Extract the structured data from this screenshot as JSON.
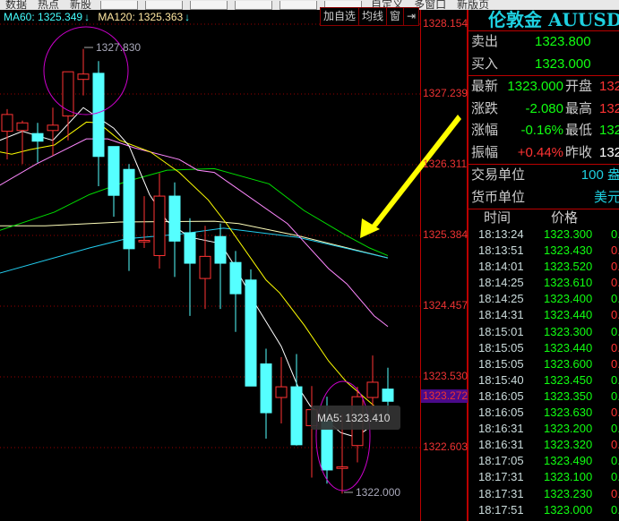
{
  "toolbar": {
    "left_items": [
      "数据",
      "热点",
      "新股"
    ],
    "right_items": [
      "自定义",
      "多窗口",
      "新版页"
    ]
  },
  "legend": {
    "ma60": "MA60: 1325.349",
    "ma60_arrow": "↓",
    "ma120": "MA120: 1325.363",
    "ma120_arrow": "↓"
  },
  "chart_buttons": [
    "加自选",
    "均线",
    "窗",
    "⇥"
  ],
  "axis_labels": [
    "1328.154",
    "1327.239",
    "1326.311",
    "1325.384",
    "1324.457",
    "1323.530",
    "1322.603"
  ],
  "current_price": "1323.272",
  "annotations": {
    "high": "1327.830",
    "low": "1322.000",
    "tooltip": "MA5: 1323.410"
  },
  "colors": {
    "up": "#ff3333",
    "down": "#55ffff",
    "ma5": "#ffffff",
    "ma10": "#ffff00",
    "ma20": "#ff88ff",
    "ma30": "#00dd00",
    "ma60": "#22ccee",
    "ma120": "#ffffbb",
    "grid": "#990000"
  },
  "chart_data": {
    "type": "candlestick",
    "ylim": [
      1322.603,
      1328.154
    ],
    "candles": [
      [
        1326.75,
        1326.97,
        1327.04,
        1326.38
      ],
      [
        1326.76,
        1326.86,
        1326.89,
        1326.32
      ],
      [
        1326.72,
        1326.62,
        1326.86,
        1326.34
      ],
      [
        1326.76,
        1326.83,
        1327.06,
        1326.43
      ],
      [
        1326.95,
        1327.53,
        1327.53,
        1326.63
      ],
      [
        1327.43,
        1327.5,
        1327.83,
        1327.22
      ],
      [
        1327.51,
        1326.42,
        1327.67,
        1326.03
      ],
      [
        1326.55,
        1325.91,
        1326.55,
        1325.63
      ],
      [
        1326.25,
        1325.21,
        1326.32,
        1324.92
      ],
      [
        1325.3,
        1325.32,
        1325.9,
        1325.22
      ],
      [
        1325.12,
        1325.9,
        1326.2,
        1324.95
      ],
      [
        1325.9,
        1325.31,
        1326.08,
        1324.84
      ],
      [
        1325.42,
        1325.02,
        1325.61,
        1324.33
      ],
      [
        1324.82,
        1325.11,
        1325.51,
        1324.42
      ],
      [
        1325.37,
        1325.02,
        1325.54,
        1324.42
      ],
      [
        1325.03,
        1324.62,
        1325.18,
        1324.12
      ],
      [
        1324.8,
        1323.41,
        1324.94,
        1323.41
      ],
      [
        1323.7,
        1323.06,
        1323.9,
        1322.72
      ],
      [
        1323.26,
        1323.4,
        1323.79,
        1322.92
      ],
      [
        1323.4,
        1322.64,
        1323.83,
        1322.63
      ],
      [
        1322.89,
        1323.1,
        1323.41,
        1322.21
      ],
      [
        1322.95,
        1322.31,
        1323.27,
        1322.13
      ],
      [
        1322.33,
        1322.35,
        1323.04,
        1322.0
      ],
      [
        1322.63,
        1323.27,
        1323.4,
        1322.41
      ],
      [
        1323.26,
        1323.46,
        1323.81,
        1323.06
      ],
      [
        1323.37,
        1323.21,
        1323.65,
        1323.05
      ]
    ],
    "ma": {
      "ma5": [
        [
          -0.5,
          1326.63
        ],
        [
          1,
          1326.75
        ],
        [
          3,
          1326.63
        ],
        [
          5,
          1327.06
        ],
        [
          7,
          1326.79
        ],
        [
          8,
          1326.56
        ],
        [
          9.35,
          1325.92
        ],
        [
          10.5,
          1325.57
        ],
        [
          12,
          1325.36
        ],
        [
          14,
          1325.28
        ],
        [
          14.8,
          1325.03
        ],
        [
          16.4,
          1324.45
        ],
        [
          18,
          1323.93
        ],
        [
          19.1,
          1323.4
        ],
        [
          19.9,
          1323.15
        ],
        [
          21.9,
          1322.8
        ],
        [
          22.9,
          1322.74
        ],
        [
          23.6,
          1322.84
        ]
      ],
      "ma10": [
        [
          -0.5,
          1326.48
        ],
        [
          0.3,
          1326.45
        ],
        [
          1.5,
          1326.51
        ],
        [
          3.1,
          1326.57
        ],
        [
          5.2,
          1326.87
        ],
        [
          6,
          1326.86
        ],
        [
          7.4,
          1326.63
        ],
        [
          9.4,
          1326.48
        ],
        [
          11.3,
          1326.21
        ],
        [
          13.2,
          1325.85
        ],
        [
          14.4,
          1325.54
        ],
        [
          17,
          1324.8
        ],
        [
          17.9,
          1324.63
        ],
        [
          19.5,
          1324.21
        ],
        [
          21.1,
          1323.74
        ],
        [
          22.3,
          1323.46
        ],
        [
          24.1,
          1323.15
        ]
      ],
      "ma20": [
        [
          -0.5,
          1326.04
        ],
        [
          1.9,
          1326.32
        ],
        [
          3.5,
          1326.48
        ],
        [
          5.2,
          1326.65
        ],
        [
          6.6,
          1326.65
        ],
        [
          8.4,
          1326.53
        ],
        [
          11.3,
          1326.38
        ],
        [
          12.5,
          1326.24
        ],
        [
          13.6,
          1326.21
        ],
        [
          18.4,
          1325.54
        ],
        [
          19.5,
          1325.3
        ],
        [
          21.1,
          1324.95
        ],
        [
          22.3,
          1324.75
        ],
        [
          24.1,
          1324.33
        ],
        [
          25,
          1324.19
        ]
      ],
      "ma30": [
        [
          -0.5,
          1325.45
        ],
        [
          3.1,
          1325.69
        ],
        [
          5.4,
          1325.92
        ],
        [
          7.8,
          1326.09
        ],
        [
          10.5,
          1326.24
        ],
        [
          13.6,
          1326.26
        ],
        [
          17.2,
          1326.06
        ],
        [
          19.5,
          1325.71
        ],
        [
          22.3,
          1325.38
        ],
        [
          23.8,
          1325.22
        ],
        [
          25,
          1325.12
        ]
      ],
      "ma60": [
        [
          -0.5,
          1324.89
        ],
        [
          5.4,
          1325.22
        ],
        [
          7.8,
          1325.34
        ],
        [
          11.3,
          1325.4
        ],
        [
          14.2,
          1325.48
        ],
        [
          19.1,
          1325.36
        ],
        [
          25,
          1325.09
        ]
      ],
      "ma120": [
        [
          -0.5,
          1325.51
        ],
        [
          2.5,
          1325.51
        ],
        [
          7.4,
          1325.56
        ],
        [
          13.6,
          1325.57
        ],
        [
          15.2,
          1325.54
        ],
        [
          19.1,
          1325.38
        ],
        [
          25,
          1325.09
        ]
      ]
    }
  },
  "panel": {
    "title": "伦敦金 AUUSD",
    "bidask": [
      {
        "label": "卖出",
        "value": "1323.800"
      },
      {
        "label": "买入",
        "value": "1323.000"
      }
    ],
    "stats": [
      {
        "l1": "最新",
        "v1": "1323.000",
        "c1": "g",
        "l2": "开盘",
        "v2": "132",
        "c2": "r"
      },
      {
        "l1": "涨跌",
        "v1": "-2.080",
        "c1": "g",
        "l2": "最高",
        "v2": "132",
        "c2": "r"
      },
      {
        "l1": "涨幅",
        "v1": "-0.16%",
        "c1": "g",
        "l2": "最低",
        "v2": "132",
        "c2": "g"
      },
      {
        "l1": "振幅",
        "v1": "+0.44%",
        "c1": "r",
        "l2": "昨收",
        "v2": "132",
        "c2": "w"
      }
    ],
    "units": [
      {
        "label": "交易单位",
        "value": "100 盎"
      },
      {
        "label": "货币单位",
        "value": "美元"
      }
    ],
    "tick_headers": [
      "时间",
      "价格"
    ],
    "ticks": [
      [
        "18:13:24",
        "1323.300",
        "0.",
        "g"
      ],
      [
        "18:13:51",
        "1323.430",
        "0.",
        "r"
      ],
      [
        "18:14:01",
        "1323.520",
        "0.",
        "r"
      ],
      [
        "18:14:25",
        "1323.610",
        "0.",
        "r"
      ],
      [
        "18:14:25",
        "1323.400",
        "0.",
        "g"
      ],
      [
        "18:14:31",
        "1323.440",
        "0.",
        "r"
      ],
      [
        "18:15:01",
        "1323.300",
        "0.",
        "g"
      ],
      [
        "18:15:05",
        "1323.440",
        "0.",
        "r"
      ],
      [
        "18:15:05",
        "1323.600",
        "0.",
        "r"
      ],
      [
        "18:15:40",
        "1323.450",
        "0.",
        "g"
      ],
      [
        "18:16:05",
        "1323.350",
        "0.",
        "g"
      ],
      [
        "18:16:05",
        "1323.630",
        "0.",
        "r"
      ],
      [
        "18:16:31",
        "1323.200",
        "0.",
        "g"
      ],
      [
        "18:16:31",
        "1323.320",
        "0.",
        "r"
      ],
      [
        "18:17:05",
        "1323.490",
        "0.",
        "g"
      ],
      [
        "18:17:31",
        "1323.100",
        "0.",
        "g"
      ],
      [
        "18:17:31",
        "1323.230",
        "0.",
        "r"
      ],
      [
        "18:17:51",
        "1323.000",
        "0.",
        "g"
      ]
    ]
  }
}
